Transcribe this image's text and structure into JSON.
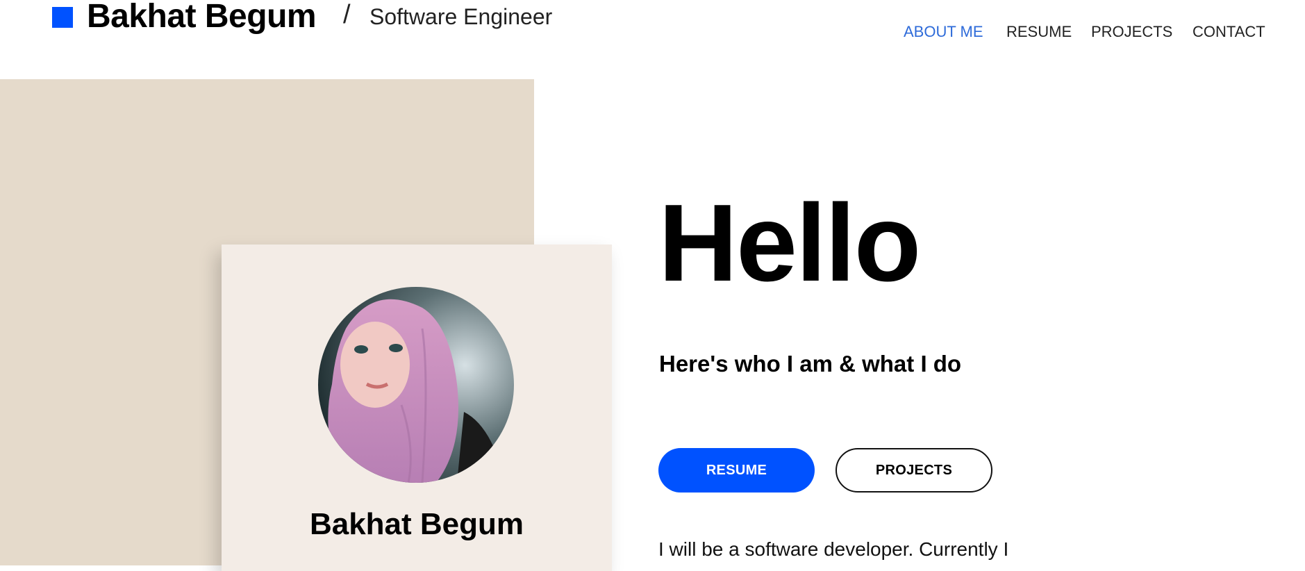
{
  "header": {
    "brand_name": "Bakhat Begum",
    "separator": "/",
    "role": "Software Engineer",
    "accent_color": "#0052ff",
    "nav": [
      {
        "label": "ABOUT ME",
        "active": true
      },
      {
        "label": "RESUME",
        "active": false
      },
      {
        "label": "PROJECTS",
        "active": false
      },
      {
        "label": "CONTACT",
        "active": false
      }
    ]
  },
  "profile_card": {
    "name": "Bakhat Begum",
    "avatar_icon": "profile-photo"
  },
  "hero": {
    "heading": "Hello",
    "subtitle": "Here's who I am & what I do",
    "primary_button": "RESUME",
    "secondary_button": "PROJECTS",
    "intro_text": "I will be a software developer. Currently I"
  }
}
